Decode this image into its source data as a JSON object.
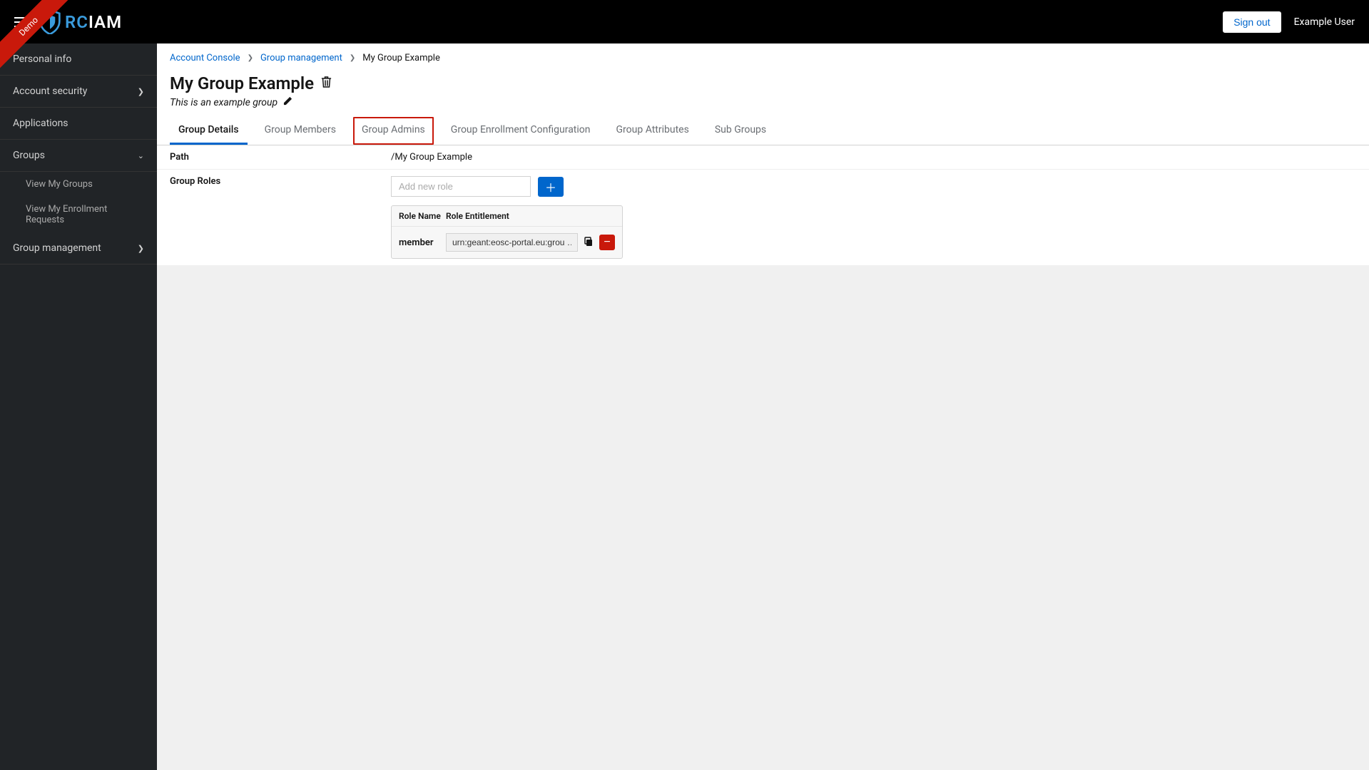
{
  "ribbon": "Demo",
  "logo": {
    "rc": "RC",
    "iam": "IAM"
  },
  "header": {
    "signout": "Sign out",
    "username": "Example User"
  },
  "sidebar": {
    "items": [
      {
        "label": "Personal info"
      },
      {
        "label": "Account security"
      },
      {
        "label": "Applications"
      },
      {
        "label": "Groups"
      },
      {
        "label": "Group management"
      }
    ],
    "groups_sub": [
      {
        "label": "View My Groups"
      },
      {
        "label": "View My Enrollment Requests"
      }
    ]
  },
  "breadcrumb": {
    "items": [
      {
        "label": "Account Console",
        "link": true
      },
      {
        "label": "Group management",
        "link": true
      },
      {
        "label": "My Group Example",
        "link": false
      }
    ]
  },
  "page": {
    "title": "My Group Example",
    "subtitle": "This is an example group"
  },
  "tabs": [
    {
      "label": "Group Details",
      "active": true
    },
    {
      "label": "Group Members"
    },
    {
      "label": "Group Admins",
      "highlight": true
    },
    {
      "label": "Group Enrollment Configuration"
    },
    {
      "label": "Group Attributes"
    },
    {
      "label": "Sub Groups"
    }
  ],
  "details": {
    "path_label": "Path",
    "path_value": "/My Group Example",
    "roles_label": "Group Roles",
    "add_role_placeholder": "Add new role",
    "table": {
      "col_name": "Role Name",
      "col_ent": "Role Entitlement",
      "rows": [
        {
          "name": "member",
          "entitlement": "urn:geant:eosc-portal.eu:grou …"
        }
      ]
    }
  }
}
